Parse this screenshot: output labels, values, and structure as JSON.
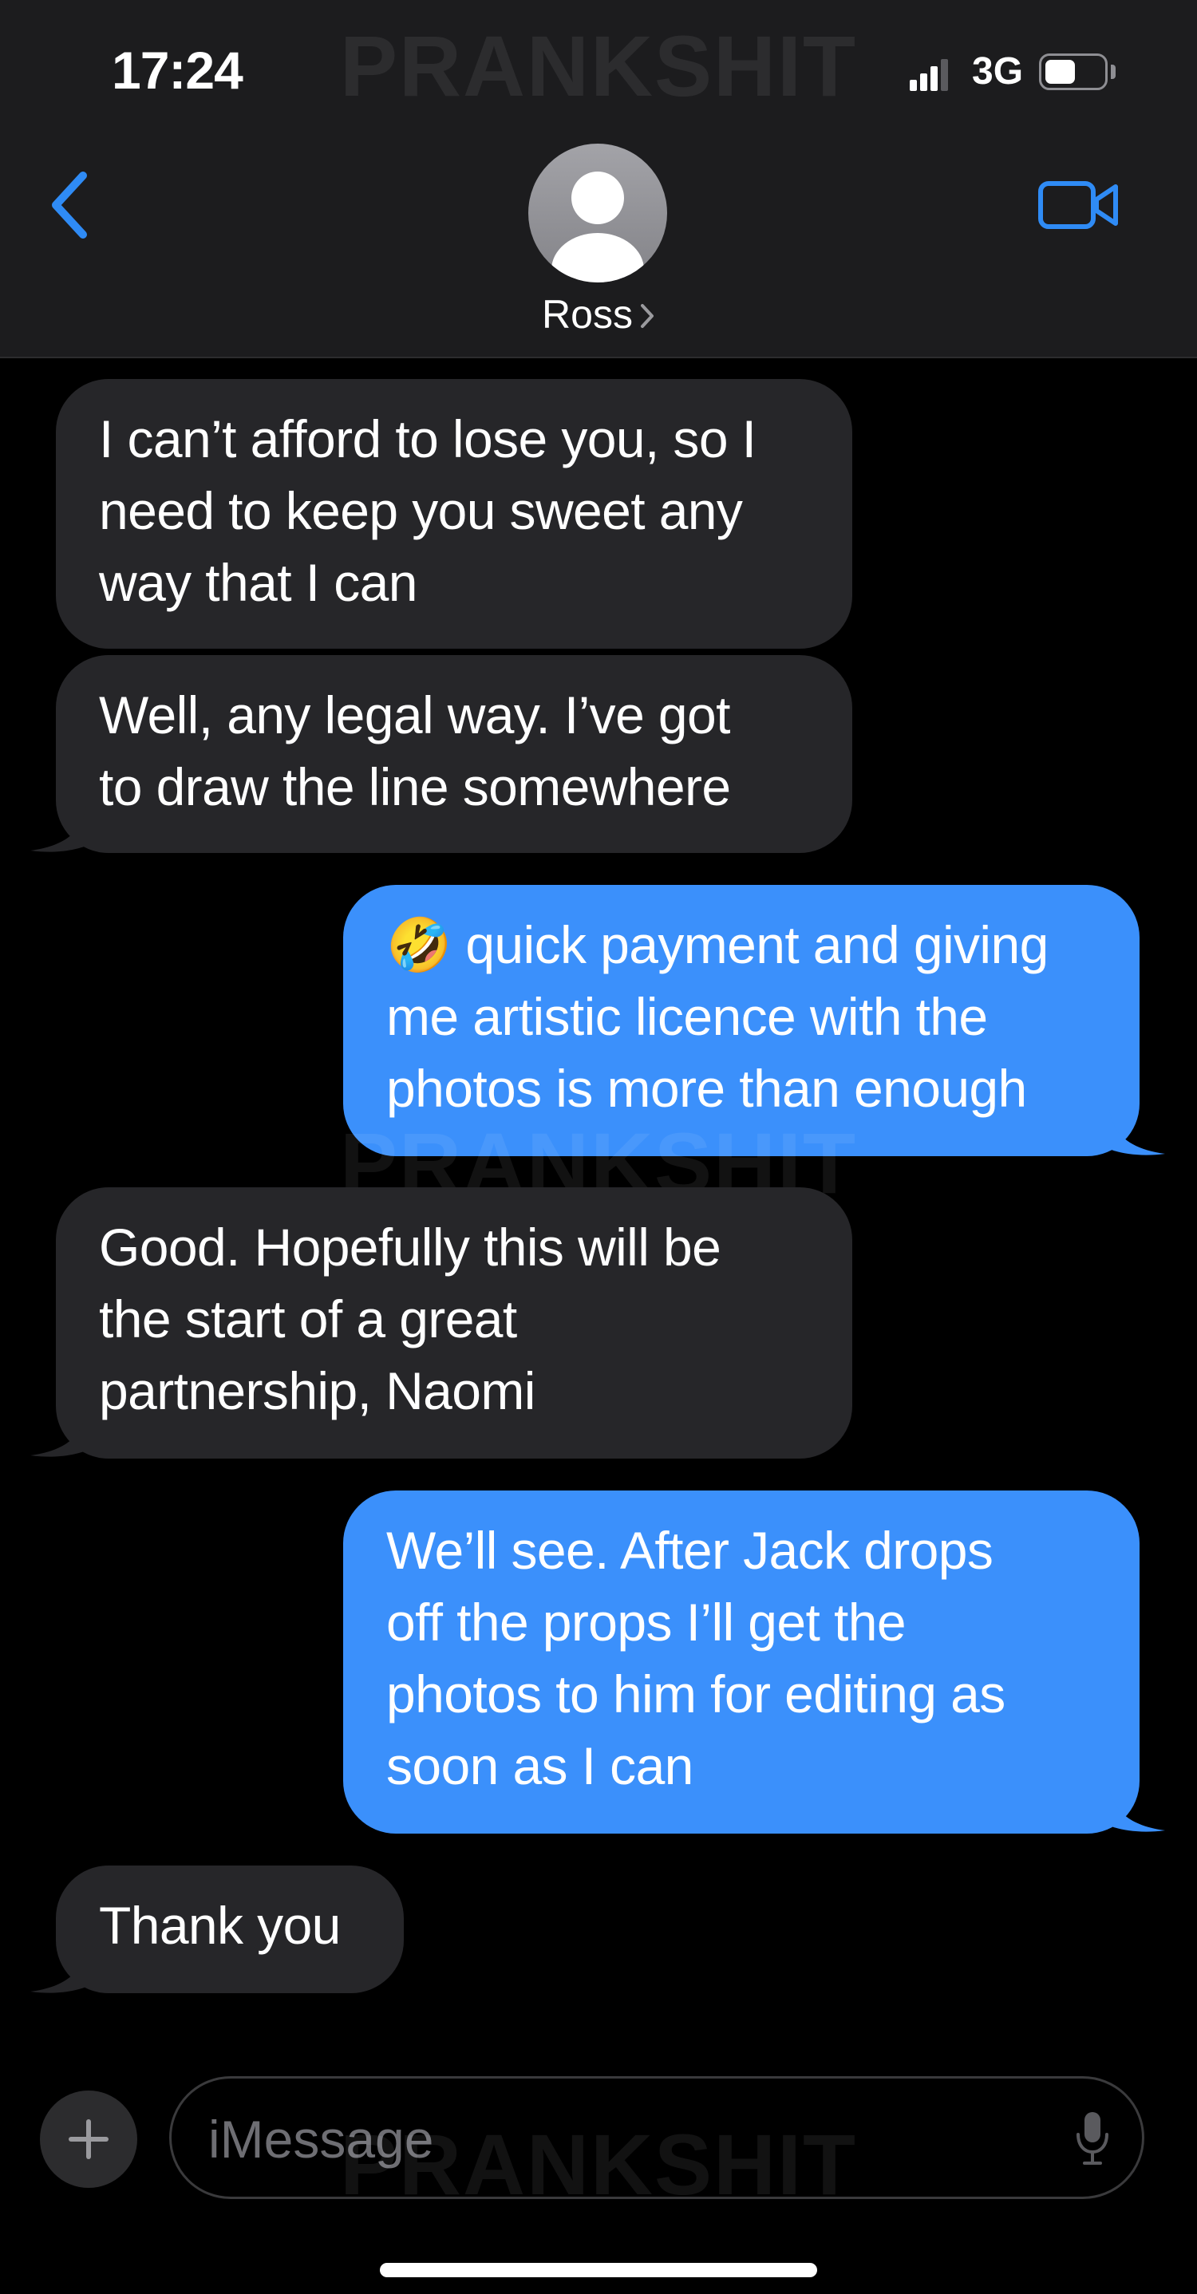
{
  "status_bar": {
    "time": "17:24",
    "network": "3G"
  },
  "header": {
    "contact_name": "Ross"
  },
  "watermark": "PRANKSHIT",
  "messages": [
    {
      "direction": "incoming",
      "lines": [
        "I can’t afford to lose you, so I",
        "need to keep you sweet any",
        "way that I can"
      ]
    },
    {
      "direction": "incoming",
      "lines": [
        "Well, any legal way. I’ve got",
        "to draw the line somewhere"
      ]
    },
    {
      "direction": "outgoing",
      "lines": [
        "🤣 quick payment and giving",
        "me artistic licence with the",
        "photos is more than enough"
      ]
    },
    {
      "direction": "incoming",
      "lines": [
        "Good. Hopefully this will be",
        "the start of a great",
        "partnership, Naomi"
      ]
    },
    {
      "direction": "outgoing",
      "lines": [
        "We’ll see. After Jack drops",
        "off the props I’ll get the",
        "photos to him for editing as",
        "soon as I can"
      ]
    },
    {
      "direction": "incoming",
      "lines": [
        "Thank you"
      ]
    }
  ],
  "composer": {
    "placeholder": "iMessage"
  },
  "colors": {
    "outgoing_bubble": "#3b90fb",
    "incoming_bubble": "#262629",
    "accent": "#2f8bf5",
    "header_bg": "#1c1c1e"
  },
  "icons": [
    "back-chevron-icon",
    "contact-avatar-icon",
    "facetime-video-icon",
    "plus-icon",
    "microphone-icon",
    "signal-icon",
    "battery-icon"
  ]
}
